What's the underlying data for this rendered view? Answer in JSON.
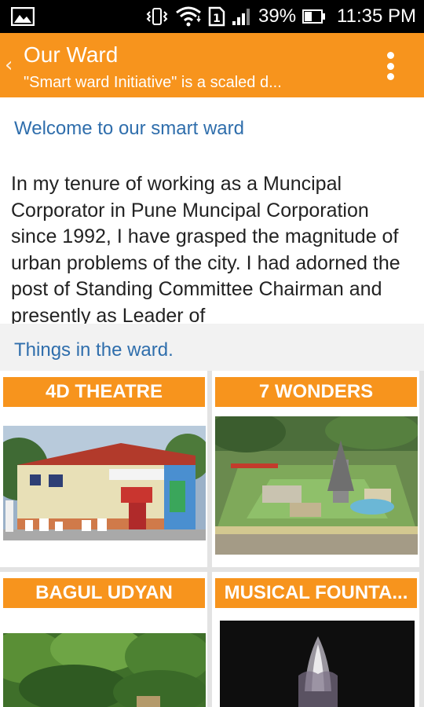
{
  "status_bar": {
    "battery_percent": "39%",
    "time": "11:35 PM",
    "icons": [
      "image-icon",
      "vibrate-icon",
      "wifi-icon",
      "sim-icon",
      "signal-icon",
      "battery-icon"
    ]
  },
  "action_bar": {
    "title": "Our Ward",
    "subtitle": "\"Smart ward Initiative\" is a scaled d...",
    "back_icon": "chevron-left-icon",
    "menu_icon": "overflow-menu-icon"
  },
  "content": {
    "welcome_link": "Welcome to our smart ward",
    "intro_text": "In my tenure of working as a Muncipal Corporator in Pune Muncipal Corporation since 1992, I have grasped the magnitude of urban problems of the city. I had adorned the post of Standing Committee Chairman and presently as Leader of",
    "things_heading": "Things in the ward."
  },
  "cards": [
    {
      "label": "4D THEATRE"
    },
    {
      "label": "7 WONDERS"
    },
    {
      "label": "BAGUL UDYAN"
    },
    {
      "label": "MUSICAL FOUNTA..."
    }
  ],
  "colors": {
    "accent": "#f7941d",
    "link": "#2f6eac",
    "status_bar": "#000000",
    "grid_bg": "#e3e3e3"
  }
}
